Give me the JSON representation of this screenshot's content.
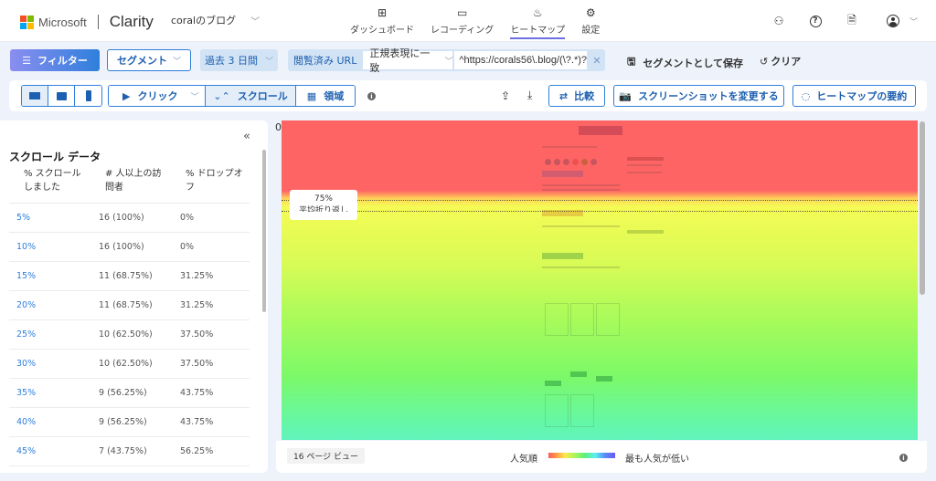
{
  "header": {
    "brand": "Microsoft",
    "product": "Clarity",
    "project": "coralのブログ",
    "nav": [
      {
        "label": "ダッシュボード",
        "icon": "dashboard-icon",
        "active": false
      },
      {
        "label": "レコーディング",
        "icon": "video-icon",
        "active": false
      },
      {
        "label": "ヒートマップ",
        "icon": "flame-icon",
        "active": true
      },
      {
        "label": "設定",
        "icon": "gear-icon",
        "active": false
      }
    ],
    "right_icons": [
      "people-icon",
      "help-icon",
      "document-icon",
      "account-icon"
    ]
  },
  "filterbar": {
    "filter_label": "フィルター",
    "segment_label": "セグメント",
    "date_label": "過去 3 日間",
    "url_filter": {
      "label": "閲覧済み URL",
      "operator": "正規表現に一致",
      "value": "^https://corals56\\.blog/(\\?.*)?$"
    },
    "save_segment_label": "セグメントとして保存",
    "clear_label": "クリア"
  },
  "toolbar": {
    "devices": [
      "desktop",
      "tablet",
      "mobile"
    ],
    "selected_device": "desktop",
    "modes": {
      "click": "クリック",
      "scroll": "スクロール",
      "area": "領域"
    },
    "selected_mode": "スクロール",
    "compare_label": "比較",
    "screenshot_label": "スクリーンショットを変更する",
    "summary_label": "ヒートマップの要約"
  },
  "scroll_panel": {
    "title": "スクロール データ",
    "columns": [
      "% スクロールしました",
      "# 人以上の訪問者",
      "% ドロップオフ"
    ],
    "rows": [
      {
        "scroll": "5%",
        "visitors": "16 (100%)",
        "dropoff": "0%"
      },
      {
        "scroll": "10%",
        "visitors": "16 (100%)",
        "dropoff": "0%"
      },
      {
        "scroll": "15%",
        "visitors": "11 (68.75%)",
        "dropoff": "31.25%"
      },
      {
        "scroll": "20%",
        "visitors": "11 (68.75%)",
        "dropoff": "31.25%"
      },
      {
        "scroll": "25%",
        "visitors": "10 (62.50%)",
        "dropoff": "37.50%"
      },
      {
        "scroll": "30%",
        "visitors": "10 (62.50%)",
        "dropoff": "37.50%"
      },
      {
        "scroll": "35%",
        "visitors": "9 (56.25%)",
        "dropoff": "43.75%"
      },
      {
        "scroll": "40%",
        "visitors": "9 (56.25%)",
        "dropoff": "43.75%"
      },
      {
        "scroll": "45%",
        "visitors": "7 (43.75%)",
        "dropoff": "56.25%"
      }
    ]
  },
  "heatmap": {
    "top_label": "0",
    "marker_percent": "75%",
    "marker_sub": "平均折り返し",
    "site_title": "coralのブログ"
  },
  "legend": {
    "page_views": "16 ページ ビュー",
    "most_popular": "人気順",
    "least_popular": "最も人気が低い"
  }
}
